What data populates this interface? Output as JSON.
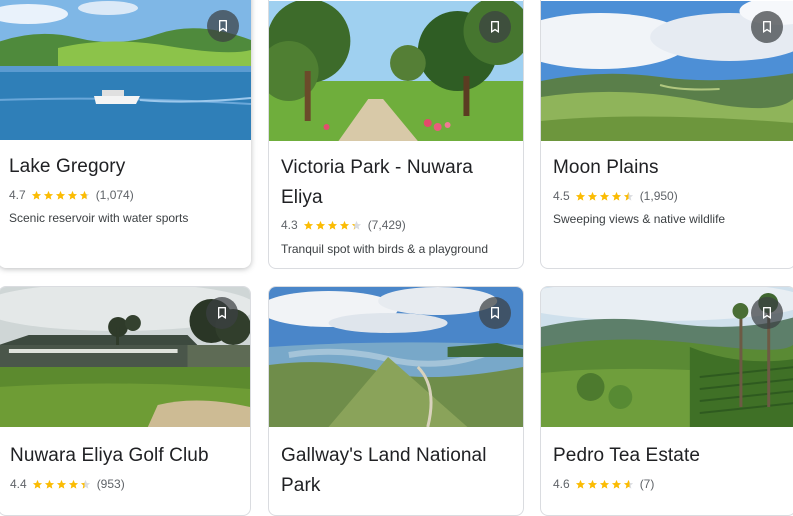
{
  "colors": {
    "star": "#fbbc04",
    "star_empty": "#dadce0",
    "text": "#202124",
    "muted": "#5f6368"
  },
  "cards": [
    {
      "title": "Lake Gregory",
      "rating": "4.7",
      "stars": 4.7,
      "reviews": "(1,074)",
      "description": "Scenic reservoir with water sports",
      "save_icon": "bookmark-icon"
    },
    {
      "title": "Victoria Park - Nuwara Eliya",
      "rating": "4.3",
      "stars": 4.3,
      "reviews": "(7,429)",
      "description": "Tranquil spot with birds & a playground",
      "save_icon": "bookmark-icon"
    },
    {
      "title": "Moon Plains",
      "rating": "4.5",
      "stars": 4.5,
      "reviews": "(1,950)",
      "description": "Sweeping views & native wildlife",
      "save_icon": "bookmark-icon"
    },
    {
      "title": "Nuwara Eliya Golf Club",
      "rating": "4.4",
      "stars": 4.4,
      "reviews": "(953)",
      "description": "",
      "save_icon": "bookmark-icon"
    },
    {
      "title": "Gallway's Land National Park",
      "rating": "",
      "stars": null,
      "reviews": "",
      "description": "",
      "save_icon": "bookmark-icon"
    },
    {
      "title": "Pedro Tea Estate",
      "rating": "4.6",
      "stars": 4.6,
      "reviews": "(7)",
      "description": "",
      "save_icon": "bookmark-icon"
    }
  ]
}
